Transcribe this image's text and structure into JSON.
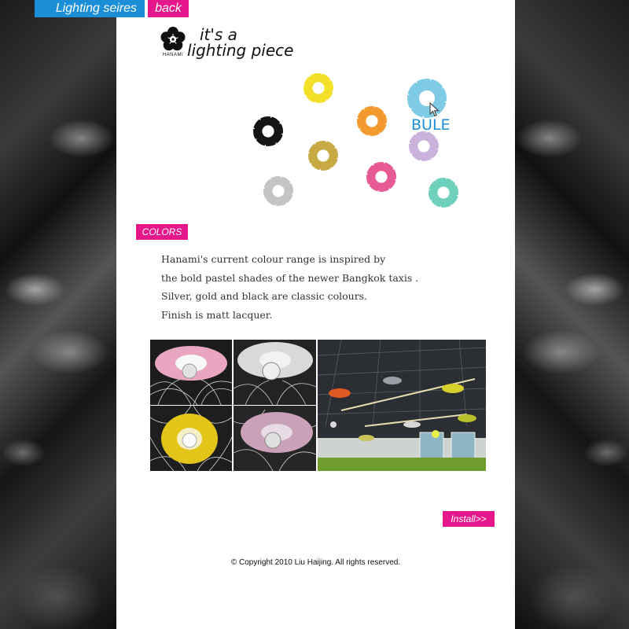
{
  "nav": {
    "series_label": "Lighting seires",
    "back_label": "back"
  },
  "logo": {
    "brand": "HANAMI",
    "tagline_line1": "it's a",
    "tagline_line2": "lighting piece"
  },
  "palette": {
    "hovered_label": "BULE",
    "rings": [
      {
        "name": "yellow",
        "color": "#f3e028"
      },
      {
        "name": "blue",
        "color": "#7fcbe6"
      },
      {
        "name": "orange",
        "color": "#f39a2e"
      },
      {
        "name": "black",
        "color": "#151515"
      },
      {
        "name": "gold",
        "color": "#c8aa45"
      },
      {
        "name": "lilac",
        "color": "#c9b2dc"
      },
      {
        "name": "pink",
        "color": "#e85a93"
      },
      {
        "name": "silver",
        "color": "#c4c4c4"
      },
      {
        "name": "mint",
        "color": "#6fd0bc"
      }
    ]
  },
  "colors_section": {
    "tag": "COLORS",
    "lines": [
      "Hanami's current colour range is inspired by",
      "the bold pastel shades of the newer Bangkok taxis .",
      "Silver, gold and black are classic colours.",
      "Finish is matt lacquer."
    ]
  },
  "install_label": "Install>>",
  "copyright": "© Copyright 2010  Liu Haijing. All rights reserved.",
  "colors": {
    "accent_pink": "#e6178a",
    "accent_blue": "#1a8fd8"
  }
}
